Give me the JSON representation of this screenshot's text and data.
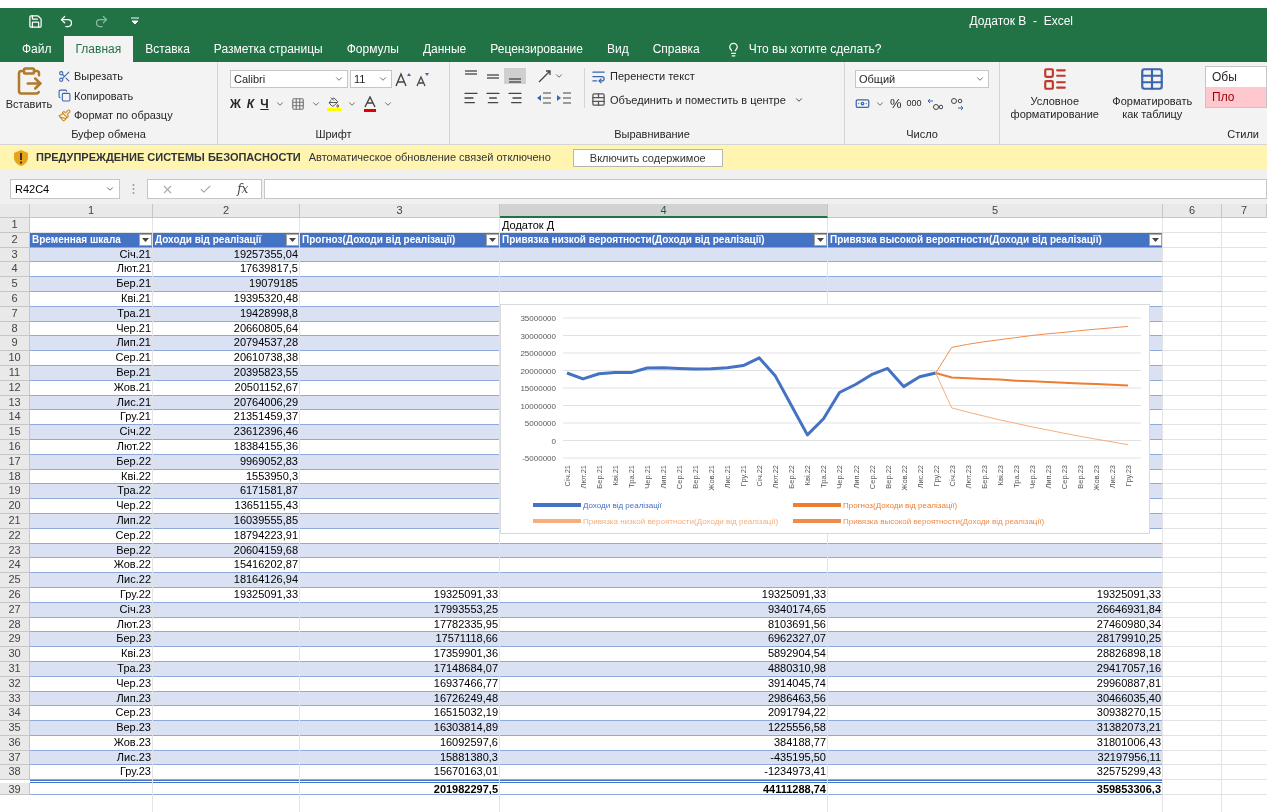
{
  "title_bar": {
    "title": "Додаток В  -  Excel"
  },
  "ribbon_tabs": [
    {
      "label": "Файл",
      "selected": false
    },
    {
      "label": "Главная",
      "selected": true
    },
    {
      "label": "Вставка",
      "selected": false
    },
    {
      "label": "Разметка страницы",
      "selected": false
    },
    {
      "label": "Формулы",
      "selected": false
    },
    {
      "label": "Данные",
      "selected": false
    },
    {
      "label": "Рецензирование",
      "selected": false
    },
    {
      "label": "Вид",
      "selected": false
    },
    {
      "label": "Справка",
      "selected": false
    }
  ],
  "tell_me": "Что вы хотите сделать?",
  "ribbon": {
    "clipboard": {
      "paste": "Вставить",
      "cut": "Вырезать",
      "copy": "Копировать",
      "format_painter": "Формат по образцу",
      "label": "Буфер обмена"
    },
    "font": {
      "name": "Calibri",
      "size": "11",
      "bold": "Ж",
      "italic": "К",
      "underline": "Ч",
      "label": "Шрифт"
    },
    "alignment": {
      "wrap": "Перенести текст",
      "merge": "Объединить и поместить в центре",
      "label": "Выравнивание"
    },
    "number": {
      "format": "Общий",
      "percent": "%",
      "thousands": "000",
      "label": "Число"
    },
    "styles": {
      "conditional": "Условное форматирование",
      "format_table": "Форматировать как таблицу",
      "style_normal": "Обы",
      "style_bad": "Пло",
      "label": "Стили"
    }
  },
  "security_bar": {
    "title": "ПРЕДУПРЕЖДЕНИЕ СИСТЕМЫ БЕЗОПАСНОСТИ",
    "message": "Автоматическое обновление связей отключено",
    "button": "Включить содержимое"
  },
  "formula_bar": {
    "name_box": "R42C4",
    "function_label": "fx"
  },
  "columns": [
    {
      "label": "1",
      "selected": false
    },
    {
      "label": "2",
      "selected": false
    },
    {
      "label": "3",
      "selected": false
    },
    {
      "label": "4",
      "selected": true
    },
    {
      "label": "5",
      "selected": false
    },
    {
      "label": "6",
      "selected": false
    },
    {
      "label": "7",
      "selected": false
    }
  ],
  "rows": [
    {
      "number": "1",
      "kind": "title",
      "cells": {
        "low": "Додаток Д"
      }
    },
    {
      "number": "2",
      "kind": "header",
      "cells": {
        "timeline": "Временная шкала",
        "revenue": "Доходи від реалізації",
        "forecast": "Прогноз(Доходи від реалізації)",
        "low": "Привязка низкой вероятности(Доходи від реалізації)",
        "high": "Привязка высокой вероятности(Доходи від реалізації)"
      }
    },
    {
      "number": "3",
      "kind": "data",
      "cells": {
        "timeline": "Січ.21",
        "revenue": "19257355,04"
      }
    },
    {
      "number": "4",
      "kind": "data",
      "cells": {
        "timeline": "Лют.21",
        "revenue": "17639817,5"
      }
    },
    {
      "number": "5",
      "kind": "data",
      "cells": {
        "timeline": "Бер.21",
        "revenue": "19079185"
      }
    },
    {
      "number": "6",
      "kind": "data",
      "cells": {
        "timeline": "Кві.21",
        "revenue": "19395320,48"
      }
    },
    {
      "number": "7",
      "kind": "data",
      "cells": {
        "timeline": "Тра.21",
        "revenue": "19428998,8"
      }
    },
    {
      "number": "8",
      "kind": "data",
      "cells": {
        "timeline": "Чер.21",
        "revenue": "20660805,64"
      }
    },
    {
      "number": "9",
      "kind": "data",
      "cells": {
        "timeline": "Лип.21",
        "revenue": "20794537,28"
      }
    },
    {
      "number": "10",
      "kind": "data",
      "cells": {
        "timeline": "Сер.21",
        "revenue": "20610738,38"
      }
    },
    {
      "number": "11",
      "kind": "data",
      "cells": {
        "timeline": "Вер.21",
        "revenue": "20395823,55"
      }
    },
    {
      "number": "12",
      "kind": "data",
      "cells": {
        "timeline": "Жов.21",
        "revenue": "20501152,67"
      }
    },
    {
      "number": "13",
      "kind": "data",
      "cells": {
        "timeline": "Лис.21",
        "revenue": "20764006,29"
      }
    },
    {
      "number": "14",
      "kind": "data",
      "cells": {
        "timeline": "Гру.21",
        "revenue": "21351459,37"
      }
    },
    {
      "number": "15",
      "kind": "data",
      "cells": {
        "timeline": "Січ.22",
        "revenue": "23612396,46"
      }
    },
    {
      "number": "16",
      "kind": "data",
      "cells": {
        "timeline": "Лют.22",
        "revenue": "18384155,36"
      }
    },
    {
      "number": "17",
      "kind": "data",
      "cells": {
        "timeline": "Бер.22",
        "revenue": "9969052,83"
      }
    },
    {
      "number": "18",
      "kind": "data",
      "cells": {
        "timeline": "Кві.22",
        "revenue": "1553950,3"
      }
    },
    {
      "number": "19",
      "kind": "data",
      "cells": {
        "timeline": "Тра.22",
        "revenue": "6171581,87"
      }
    },
    {
      "number": "20",
      "kind": "data",
      "cells": {
        "timeline": "Чер.22",
        "revenue": "13651155,43"
      }
    },
    {
      "number": "21",
      "kind": "data",
      "cells": {
        "timeline": "Лип.22",
        "revenue": "16039555,85"
      }
    },
    {
      "number": "22",
      "kind": "data",
      "cells": {
        "timeline": "Сер.22",
        "revenue": "18794223,91"
      }
    },
    {
      "number": "23",
      "kind": "data",
      "cells": {
        "timeline": "Вер.22",
        "revenue": "20604159,68"
      }
    },
    {
      "number": "24",
      "kind": "data",
      "cells": {
        "timeline": "Жов.22",
        "revenue": "15416202,87"
      }
    },
    {
      "number": "25",
      "kind": "data",
      "cells": {
        "timeline": "Лис.22",
        "revenue": "18164126,94"
      }
    },
    {
      "number": "26",
      "kind": "data",
      "cells": {
        "timeline": "Гру.22",
        "revenue": "19325091,33",
        "forecast": "19325091,33",
        "low": "19325091,33",
        "high": "19325091,33"
      }
    },
    {
      "number": "27",
      "kind": "data",
      "cells": {
        "timeline": "Січ.23",
        "forecast": "17993553,25",
        "low": "9340174,65",
        "high": "26646931,84"
      }
    },
    {
      "number": "28",
      "kind": "data",
      "cells": {
        "timeline": "Лют.23",
        "forecast": "17782335,95",
        "low": "8103691,56",
        "high": "27460980,34"
      }
    },
    {
      "number": "29",
      "kind": "data",
      "cells": {
        "timeline": "Бер.23",
        "forecast": "17571118,66",
        "low": "6962327,07",
        "high": "28179910,25"
      }
    },
    {
      "number": "30",
      "kind": "data",
      "cells": {
        "timeline": "Кві.23",
        "forecast": "17359901,36",
        "low": "5892904,54",
        "high": "28826898,18"
      }
    },
    {
      "number": "31",
      "kind": "data",
      "cells": {
        "timeline": "Тра.23",
        "forecast": "17148684,07",
        "low": "4880310,98",
        "high": "29417057,16"
      }
    },
    {
      "number": "32",
      "kind": "data",
      "cells": {
        "timeline": "Чер.23",
        "forecast": "16937466,77",
        "low": "3914045,74",
        "high": "29960887,81"
      }
    },
    {
      "number": "33",
      "kind": "data",
      "cells": {
        "timeline": "Лип.23",
        "forecast": "16726249,48",
        "low": "2986463,56",
        "high": "30466035,40"
      }
    },
    {
      "number": "34",
      "kind": "data",
      "cells": {
        "timeline": "Сер.23",
        "forecast": "16515032,19",
        "low": "2091794,22",
        "high": "30938270,15"
      }
    },
    {
      "number": "35",
      "kind": "data",
      "cells": {
        "timeline": "Вер.23",
        "forecast": "16303814,89",
        "low": "1225556,58",
        "high": "31382073,21"
      }
    },
    {
      "number": "36",
      "kind": "data",
      "cells": {
        "timeline": "Жов.23",
        "forecast": "16092597,6",
        "low": "384188,77",
        "high": "31801006,43"
      }
    },
    {
      "number": "37",
      "kind": "data",
      "cells": {
        "timeline": "Лис.23",
        "forecast": "15881380,3",
        "low": "-435195,50",
        "high": "32197956,11"
      }
    },
    {
      "number": "38",
      "kind": "data",
      "cells": {
        "timeline": "Гру.23",
        "forecast": "15670163,01",
        "low": "-1234973,41",
        "high": "32575299,43"
      }
    },
    {
      "number": "39",
      "kind": "total",
      "cells": {
        "forecast": "201982297,5",
        "low": "44111288,74",
        "high": "359853306,3"
      }
    }
  ],
  "chart_data": {
    "type": "line",
    "grid": true,
    "categories": [
      "Січ.21",
      "Лют.21",
      "Бер.21",
      "Кві.21",
      "Тра.21",
      "Чер.21",
      "Лип.21",
      "Сер.21",
      "Вер.21",
      "Жов.21",
      "Лис.21",
      "Гру.21",
      "Січ.22",
      "Лют.22",
      "Бер.22",
      "Кві.22",
      "Тра.22",
      "Чер.22",
      "Лип.22",
      "Сер.22",
      "Вер.22",
      "Жов.22",
      "Лис.22",
      "Гру.22",
      "Січ.23",
      "Лют.23",
      "Бер.23",
      "Кві.23",
      "Тра.23",
      "Чер.23",
      "Лип.23",
      "Сер.23",
      "Вер.23",
      "Жов.23",
      "Лис.23",
      "Гру.23"
    ],
    "ylim": [
      -5000000,
      35000000
    ],
    "yticks": [
      -5000000,
      0,
      5000000,
      10000000,
      15000000,
      20000000,
      25000000,
      30000000,
      35000000
    ],
    "series": [
      {
        "name": "Доходи від реалізації",
        "color": "#4472c4",
        "values": [
          19300000,
          17600000,
          19100000,
          19400000,
          19400000,
          20700000,
          20800000,
          20600000,
          20400000,
          20500000,
          20800000,
          21400000,
          23600000,
          18400000,
          10000000,
          1600000,
          6200000,
          13700000,
          16000000,
          18800000,
          20600000,
          15400000,
          18200000,
          19300000,
          null,
          null,
          null,
          null,
          null,
          null,
          null,
          null,
          null,
          null,
          null,
          null
        ]
      },
      {
        "name": "Прогноз(Доходи від реалізації)",
        "color": "#ed7d31",
        "values": [
          null,
          null,
          null,
          null,
          null,
          null,
          null,
          null,
          null,
          null,
          null,
          null,
          null,
          null,
          null,
          null,
          null,
          null,
          null,
          null,
          null,
          null,
          null,
          19300000,
          18000000,
          17800000,
          17600000,
          17400000,
          17100000,
          16900000,
          16700000,
          16500000,
          16300000,
          16100000,
          15900000,
          15700000
        ]
      },
      {
        "name": "Привязка низкой вероятности(Доходи від реалізації)",
        "color": "#f6ae7c",
        "values": [
          null,
          null,
          null,
          null,
          null,
          null,
          null,
          null,
          null,
          null,
          null,
          null,
          null,
          null,
          null,
          null,
          null,
          null,
          null,
          null,
          null,
          null,
          null,
          19300000,
          9300000,
          8100000,
          7000000,
          5900000,
          4900000,
          3900000,
          3000000,
          2100000,
          1200000,
          400000,
          -400000,
          -1200000
        ]
      },
      {
        "name": "Привязка высокой вероятности(Доходи від реалізації)",
        "color": "#ef8c4c",
        "values": [
          null,
          null,
          null,
          null,
          null,
          null,
          null,
          null,
          null,
          null,
          null,
          null,
          null,
          null,
          null,
          null,
          null,
          null,
          null,
          null,
          null,
          null,
          null,
          19300000,
          26600000,
          27500000,
          28200000,
          28800000,
          29400000,
          30000000,
          30500000,
          30900000,
          31400000,
          31800000,
          32200000,
          32600000
        ]
      }
    ]
  }
}
